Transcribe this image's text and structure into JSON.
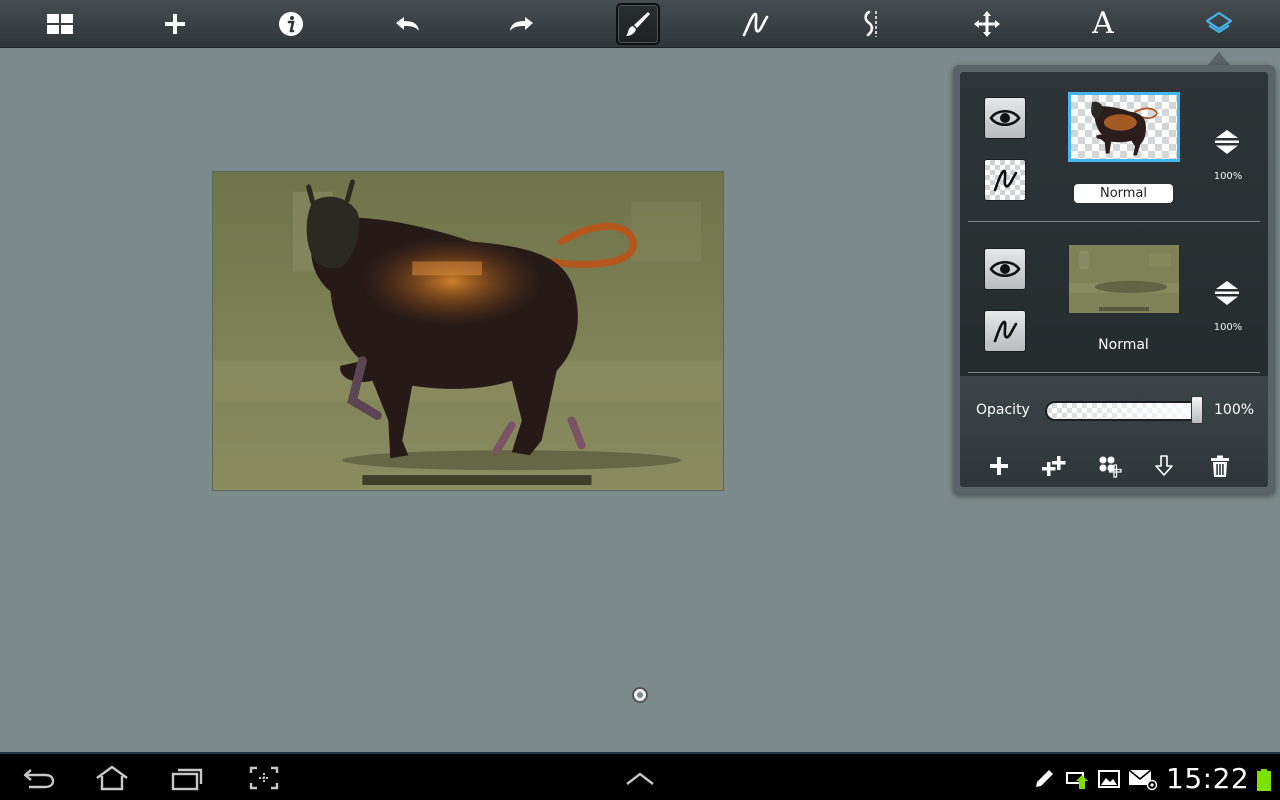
{
  "toolbar": {
    "tools": [
      {
        "name": "gallery-icon",
        "label": "Gallery"
      },
      {
        "name": "new-icon",
        "label": "New"
      },
      {
        "name": "info-icon",
        "label": "Info"
      },
      {
        "name": "undo-icon",
        "label": "Undo"
      },
      {
        "name": "redo-icon",
        "label": "Redo"
      },
      {
        "name": "brush-icon",
        "label": "Brush",
        "active": true
      },
      {
        "name": "stroke-icon",
        "label": "Stroke"
      },
      {
        "name": "symmetry-icon",
        "label": "Symmetry"
      },
      {
        "name": "move-icon",
        "label": "Transform"
      },
      {
        "name": "text-icon",
        "label": "Text",
        "glyph": "A"
      },
      {
        "name": "layers-icon",
        "label": "Layers",
        "active_color": "#46b7ee"
      }
    ]
  },
  "layers_panel": {
    "layers": [
      {
        "blend_mode": "Normal",
        "opacity": "100%",
        "selected": true,
        "visible": true
      },
      {
        "blend_mode": "Normal",
        "opacity": "100%",
        "selected": false,
        "visible": true
      }
    ],
    "opacity_label": "Opacity",
    "opacity_value": "100%",
    "opacity_level": 1.0,
    "actions": [
      {
        "name": "add-layer-icon"
      },
      {
        "name": "duplicate-layer-icon"
      },
      {
        "name": "add-image-layer-icon"
      },
      {
        "name": "merge-down-icon"
      },
      {
        "name": "delete-layer-icon"
      }
    ]
  },
  "system_bar": {
    "clock": "15:22",
    "battery_color": "#7ee000",
    "accent_color": "#46b7ee"
  }
}
